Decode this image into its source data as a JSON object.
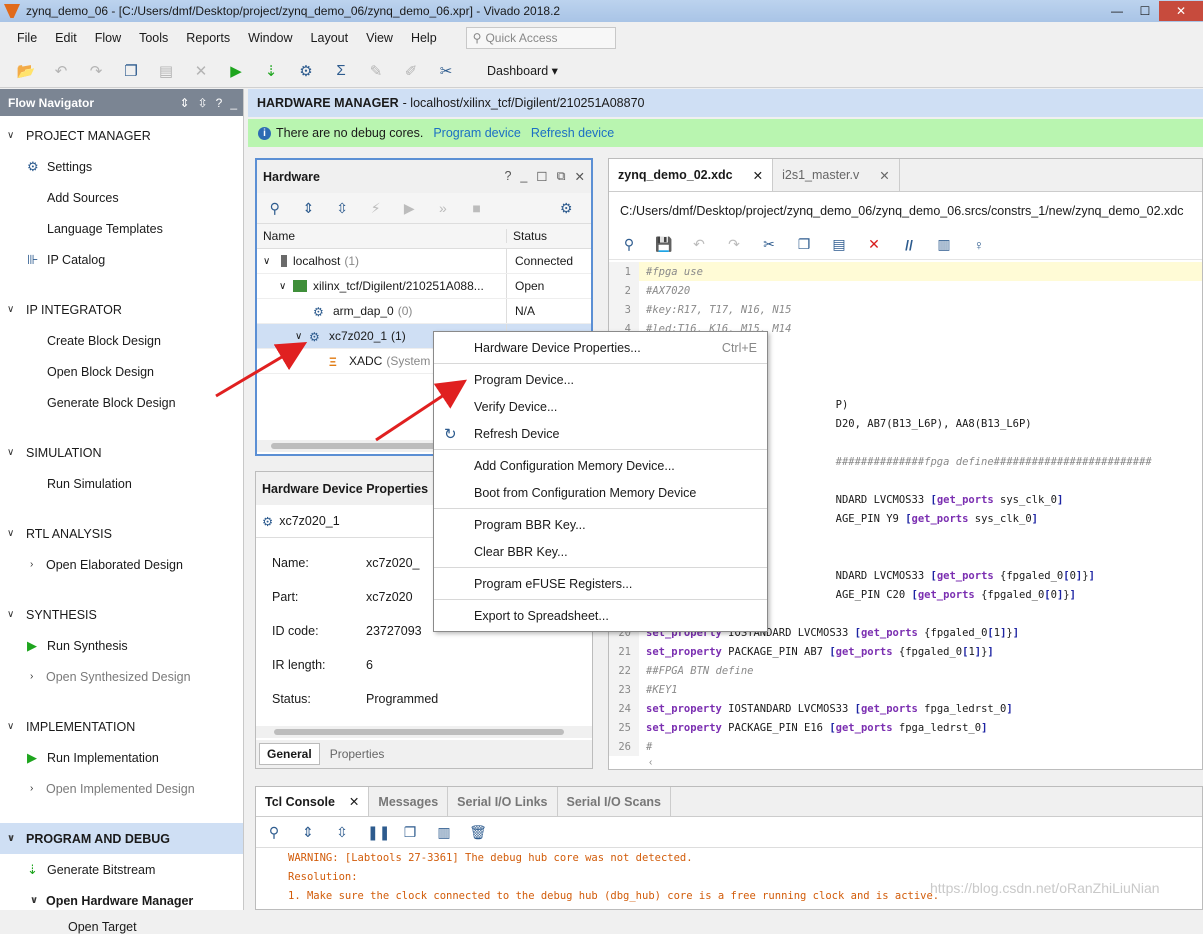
{
  "window": {
    "title": "zynq_demo_06 - [C:/Users/dmf/Desktop/project/zynq_demo_06/zynq_demo_06.xpr] - Vivado 2018.2"
  },
  "menu": [
    "File",
    "Edit",
    "Flow",
    "Tools",
    "Reports",
    "Window",
    "Layout",
    "View",
    "Help"
  ],
  "quick_access": {
    "placeholder": "Quick Access"
  },
  "toolbar": {
    "dashboard_label": "Dashboard"
  },
  "flow_navigator": {
    "title": "Flow Navigator",
    "sections": [
      {
        "label": "PROJECT MANAGER",
        "items": [
          "Settings",
          "Add Sources",
          "Language Templates",
          "IP Catalog"
        ]
      },
      {
        "label": "IP INTEGRATOR",
        "items": [
          "Create Block Design",
          "Open Block Design",
          "Generate Block Design"
        ]
      },
      {
        "label": "SIMULATION",
        "items": [
          "Run Simulation"
        ]
      },
      {
        "label": "RTL ANALYSIS",
        "items": [
          "Open Elaborated Design"
        ]
      },
      {
        "label": "SYNTHESIS",
        "items": [
          "Run Synthesis",
          "Open Synthesized Design"
        ]
      },
      {
        "label": "IMPLEMENTATION",
        "items": [
          "Run Implementation",
          "Open Implemented Design"
        ]
      },
      {
        "label": "PROGRAM AND DEBUG",
        "items": [
          "Generate Bitstream",
          "Open Hardware Manager",
          "Open Target"
        ]
      }
    ]
  },
  "hw_manager": {
    "title": "HARDWARE MANAGER",
    "target": "- localhost/xilinx_tcf/Digilent/210251A08870",
    "banner": "There are no debug cores.",
    "program_link": "Program device",
    "refresh_link": "Refresh device"
  },
  "hardware_panel": {
    "title": "Hardware",
    "col_name": "Name",
    "col_status": "Status",
    "rows": [
      {
        "name": "localhost",
        "count": "(1)",
        "status": "Connected"
      },
      {
        "name": "xilinx_tcf/Digilent/210251A088...",
        "count": "",
        "status": "Open"
      },
      {
        "name": "arm_dap_0",
        "count": "(0)",
        "status": "N/A"
      },
      {
        "name": "xc7z020_1",
        "count": "(1)",
        "status": ""
      },
      {
        "name": "XADC",
        "count": "(System M",
        "status": ""
      }
    ]
  },
  "device_props": {
    "title": "Hardware Device Properties",
    "device": "xc7z020_1",
    "fields": [
      {
        "k": "Name:",
        "v": "xc7z020_"
      },
      {
        "k": "Part:",
        "v": "xc7z020"
      },
      {
        "k": "ID code:",
        "v": "23727093"
      },
      {
        "k": "IR length:",
        "v": "6"
      },
      {
        "k": "Status:",
        "v": "Programmed"
      }
    ],
    "tab_general": "General",
    "tab_properties": "Properties"
  },
  "editor": {
    "tab1": "zynq_demo_02.xdc",
    "tab2": "i2s1_master.v",
    "path": "C:/Users/dmf/Desktop/project/zynq_demo_06/zynq_demo_06.srcs/constrs_1/new/zynq_demo_02.xdc",
    "lines": [
      {
        "n": "1",
        "t": "#fpga use"
      },
      {
        "n": "2",
        "t": "#AX7020"
      },
      {
        "n": "3",
        "t": "#key:R17, T17, N16, N15"
      },
      {
        "n": "4",
        "t": "#led:T16, K16, M15, M14"
      },
      {
        "n": "5",
        "t": ""
      },
      {
        "n": "6",
        "t": ""
      },
      {
        "n": "7",
        "t": ""
      },
      {
        "n": "8",
        "t": "                              P)"
      },
      {
        "n": "9",
        "t": "                              D20, AB7(B13_L6P), AA8(B13_L6P)"
      },
      {
        "n": "10",
        "t": ""
      },
      {
        "n": "11",
        "t": "                              ##############fpga define#########################"
      },
      {
        "n": "12",
        "t": ""
      },
      {
        "n": "13",
        "t": "                              NDARD LVCMOS33 [get_ports sys_clk_0]"
      },
      {
        "n": "14",
        "t": "                              AGE_PIN Y9 [get_ports sys_clk_0]"
      },
      {
        "n": "15",
        "t": ""
      },
      {
        "n": "16",
        "t": ""
      },
      {
        "n": "17",
        "t": "                              NDARD LVCMOS33 [get_ports {fpgaled_0[0]}]"
      },
      {
        "n": "18",
        "t": "                              AGE_PIN C20 [get_ports {fpgaled_0[0]}]"
      },
      {
        "n": "19",
        "t": ""
      },
      {
        "n": "20",
        "t": "set_property IOSTANDARD LVCMOS33 [get_ports {fpgaled_0[1]}]"
      },
      {
        "n": "21",
        "t": "set_property PACKAGE_PIN AB7 [get_ports {fpgaled_0[1]}]"
      },
      {
        "n": "22",
        "t": "##FPGA BTN define"
      },
      {
        "n": "23",
        "t": "#KEY1"
      },
      {
        "n": "24",
        "t": "set_property IOSTANDARD LVCMOS33 [get_ports fpga_ledrst_0]"
      },
      {
        "n": "25",
        "t": "set_property PACKAGE_PIN E16 [get_ports fpga_ledrst_0]"
      },
      {
        "n": "26",
        "t": "#"
      }
    ]
  },
  "console": {
    "tabs": [
      "Tcl Console",
      "Messages",
      "Serial I/O Links",
      "Serial I/O Scans"
    ],
    "lines": [
      "WARNING: [Labtools 27-3361] The debug hub core was not detected.",
      "Resolution:",
      "1. Make sure the clock connected to the debug hub (dbg_hub) core is a free running clock and is active."
    ]
  },
  "context_menu": {
    "items": [
      {
        "label": "Hardware Device Properties...",
        "shortcut": "Ctrl+E"
      },
      {
        "label": "Program Device..."
      },
      {
        "label": "Verify Device..."
      },
      {
        "label": "Refresh Device"
      },
      {
        "label": "Add Configuration Memory Device..."
      },
      {
        "label": "Boot from Configuration Memory Device"
      },
      {
        "label": "Program BBR Key..."
      },
      {
        "label": "Clear BBR Key..."
      },
      {
        "label": "Program eFUSE Registers..."
      },
      {
        "label": "Export to Spreadsheet..."
      }
    ]
  },
  "watermark": "https://blog.csdn.net/oRanZhiLiuNian",
  "colors": {
    "accent": "#2d5b8e",
    "selection": "#cfdff4",
    "banner": "#b9f5b0",
    "arrow": "#e02020"
  }
}
